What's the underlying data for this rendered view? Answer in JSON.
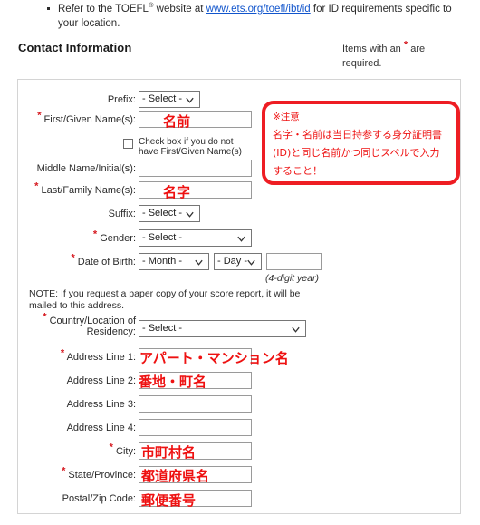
{
  "intro": {
    "bullet_text_before": "Refer to the TOEFL",
    "registered_mark": "®",
    "bullet_text_mid": " website at ",
    "link_text": "www.ets.org/toefl/ibt/id",
    "bullet_text_after": " for ID requirements specific to your location."
  },
  "header": {
    "section_title": "Contact Information",
    "required_note_before": "Items with an ",
    "required_note_marker": "*",
    "required_note_after": " are required."
  },
  "form": {
    "rows": {
      "prefix": {
        "label": "Prefix:",
        "value": "- Select -",
        "required": false
      },
      "first_name": {
        "label": "First/Given Name(s):",
        "value": "名前",
        "required": true
      },
      "no_first_name_checkbox": {
        "label": "Check box if you do not have First/Given Name(s)",
        "checked": false
      },
      "middle_name": {
        "label": "Middle Name/Initial(s):",
        "value": "",
        "required": false
      },
      "last_name": {
        "label": "Last/Family Name(s):",
        "value": "名字",
        "required": true
      },
      "suffix": {
        "label": "Suffix:",
        "value": "- Select -",
        "required": false
      },
      "gender": {
        "label": "Gender:",
        "value": "- Select -",
        "required": true
      },
      "dob": {
        "label": "Date of Birth:",
        "month_value": "- Month -",
        "day_value": "- Day -",
        "year_value": "",
        "hint": "(4-digit year)",
        "required": true
      },
      "note": "NOTE: If you request a paper copy of your score report, it will be mailed to this address.",
      "country": {
        "label": "Country/Location of Residency:",
        "value": "- Select -",
        "required": true
      },
      "address1": {
        "label": "Address Line 1:",
        "value": "アパート・マンション名",
        "required": true
      },
      "address2": {
        "label": "Address Line 2:",
        "value": "番地・町名",
        "required": false
      },
      "address3": {
        "label": "Address Line 3:",
        "value": "",
        "required": false
      },
      "address4": {
        "label": "Address Line 4:",
        "value": "",
        "required": false
      },
      "city": {
        "label": "City:",
        "value": "市町村名",
        "required": true
      },
      "state": {
        "label": "State/Province:",
        "value": "都道府県名",
        "required": true
      },
      "postal": {
        "label": "Postal/Zip Code:",
        "value": "郵便番号",
        "required": false
      }
    }
  },
  "callout": {
    "title": "※注意",
    "line1": "名字・名前は当日持参する身分証明書",
    "line2": "(ID)と同じ名前かつ同じスペルで入力",
    "line3": "すること！"
  },
  "colors": {
    "annotation_red": "#ee1d23",
    "required_asterisk": "#d61a21",
    "link_blue": "#1155cc",
    "panel_border": "#d4d4d4"
  },
  "icons": {
    "select_caret": "chevron-down-icon"
  }
}
